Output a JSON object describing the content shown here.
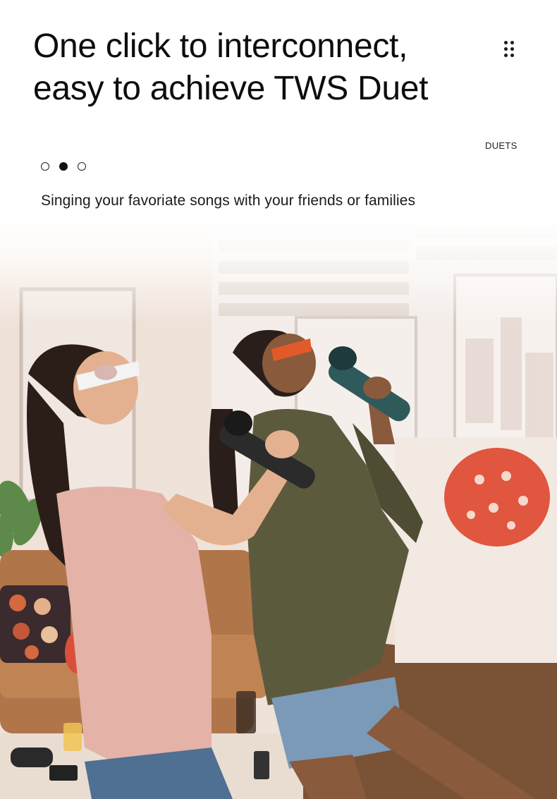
{
  "header": {
    "title_line1": "One click to interconnect,",
    "title_line2": "easy to achieve TWS Duet",
    "menu_icon": "dots-grid-icon"
  },
  "section": {
    "label": "DUETS"
  },
  "pager": {
    "total": 3,
    "active_index": 1
  },
  "tagline": "Singing your favoriate songs with your friends or families",
  "photo": {
    "subject": "two women singing with wireless microphones in a living room"
  },
  "colors": {
    "text": "#0d0d0d",
    "balloon": "#e0563e",
    "microphone_teal": "#2f5a5c",
    "microphone_dark": "#2b2b2b"
  }
}
